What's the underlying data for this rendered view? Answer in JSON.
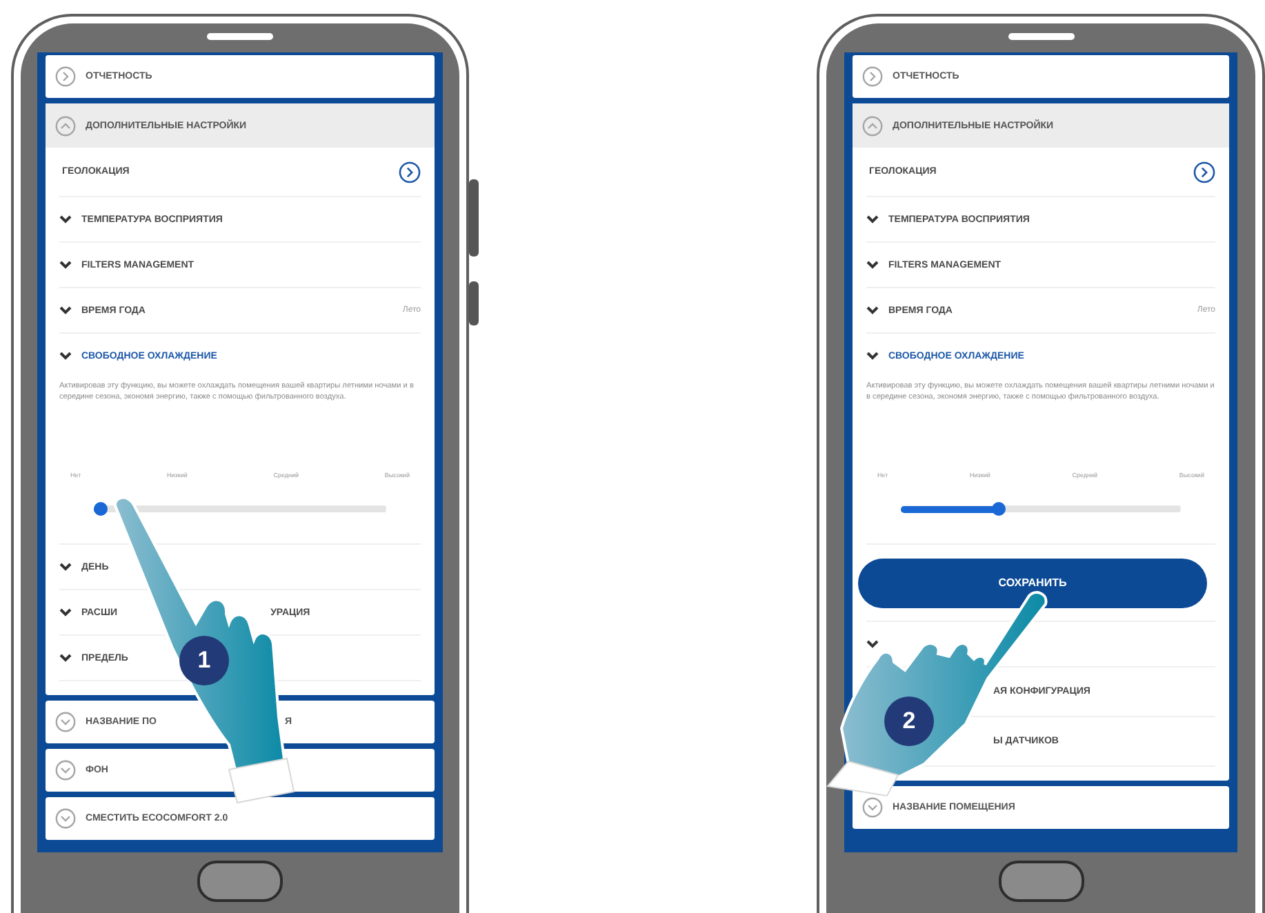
{
  "phones": [
    {
      "sections": [
        {
          "kind": "link",
          "label": "ОТЧЕТНОСТЬ"
        },
        {
          "kind": "group",
          "label": "ДОПОЛНИТЕЛЬНЫЕ НАСТРОЙКИ",
          "expanded": true,
          "items": [
            {
              "kind": "link",
              "label": "ГЕОЛОКАЦИЯ"
            },
            {
              "kind": "group",
              "label": "ТЕМПЕРАТУРА ВОСПРИЯТИЯ",
              "expanded": false
            },
            {
              "kind": "group",
              "label": "FILTERS MANAGEMENT",
              "expanded": false
            },
            {
              "kind": "group",
              "label": "ВРЕМЯ ГОДА",
              "value": "Лето",
              "expanded": false
            },
            {
              "kind": "group",
              "label": "СВОБОДНОЕ ОХЛАЖДЕНИЕ",
              "expanded": true
            },
            {
              "kind": "text",
              "text": "Активировав эту функцию, вы можете охлаждать помещения вашей квартиры летними ночами и в середине сезона, экономя энергию, также с помощью фильтрованного воздуха."
            },
            {
              "kind": "slider",
              "ticks": [
                "Нет",
                "Низкий",
                "Средний",
                "Высокий"
              ],
              "level": 0
            },
            {
              "kind": "group",
              "label": "ДЕНЬ",
              "expanded": false
            },
            {
              "kind": "group",
              "label": "РАСШИ",
              "tail": "УРАЦИЯ",
              "expanded": false
            },
            {
              "kind": "group",
              "label": "ПРЕДЕЛЬ",
              "expanded": false
            }
          ]
        },
        {
          "kind": "group",
          "label": "НАЗВАНИЕ ПО",
          "tail": "Я",
          "expanded": false
        },
        {
          "kind": "group",
          "label": "ФОН",
          "expanded": false
        },
        {
          "kind": "group",
          "label": "СМЕСТИТЬ ECOCOMFORT 2.0",
          "expanded": false
        }
      ],
      "gesture": {
        "step": "1"
      }
    },
    {
      "sections": [
        {
          "kind": "link",
          "label": "ОТЧЕТНОСТЬ"
        },
        {
          "kind": "group",
          "label": "ДОПОЛНИТЕЛЬНЫЕ НАСТРОЙКИ",
          "expanded": true,
          "items": [
            {
              "kind": "link",
              "label": "ГЕОЛОКАЦИЯ"
            },
            {
              "kind": "group",
              "label": "ТЕМПЕРАТУРА ВОСПРИЯТИЯ",
              "expanded": false
            },
            {
              "kind": "group",
              "label": "FILTERS MANAGEMENT",
              "expanded": false
            },
            {
              "kind": "group",
              "label": "ВРЕМЯ ГОДА",
              "value": "Лето",
              "expanded": false
            },
            {
              "kind": "group",
              "label": "СВОБОДНОЕ ОХЛАЖДЕНИЕ",
              "expanded": true
            },
            {
              "kind": "text",
              "text": "Активировав эту функцию, вы можете охлаждать помещения вашей квартиры летними ночами и в середине сезона, экономя энергию, также с помощью фильтрованного воздуха."
            },
            {
              "kind": "slider",
              "ticks": [
                "Нет",
                "Низкий",
                "Средний",
                "Высокий"
              ],
              "level": 0.34
            },
            {
              "kind": "button",
              "label": "СОХРАНИТЬ"
            },
            {
              "kind": "group",
              "expanded": false
            },
            {
              "kind": "covered",
              "label": "АЯ КОНФИГУРАЦИЯ"
            },
            {
              "kind": "covered",
              "label": "Ы ДАТЧИКОВ"
            }
          ]
        },
        {
          "kind": "group",
          "label": "НАЗВАНИЕ ПОМЕЩЕНИЯ",
          "expanded": false
        }
      ],
      "gesture": {
        "step": "2"
      }
    }
  ]
}
